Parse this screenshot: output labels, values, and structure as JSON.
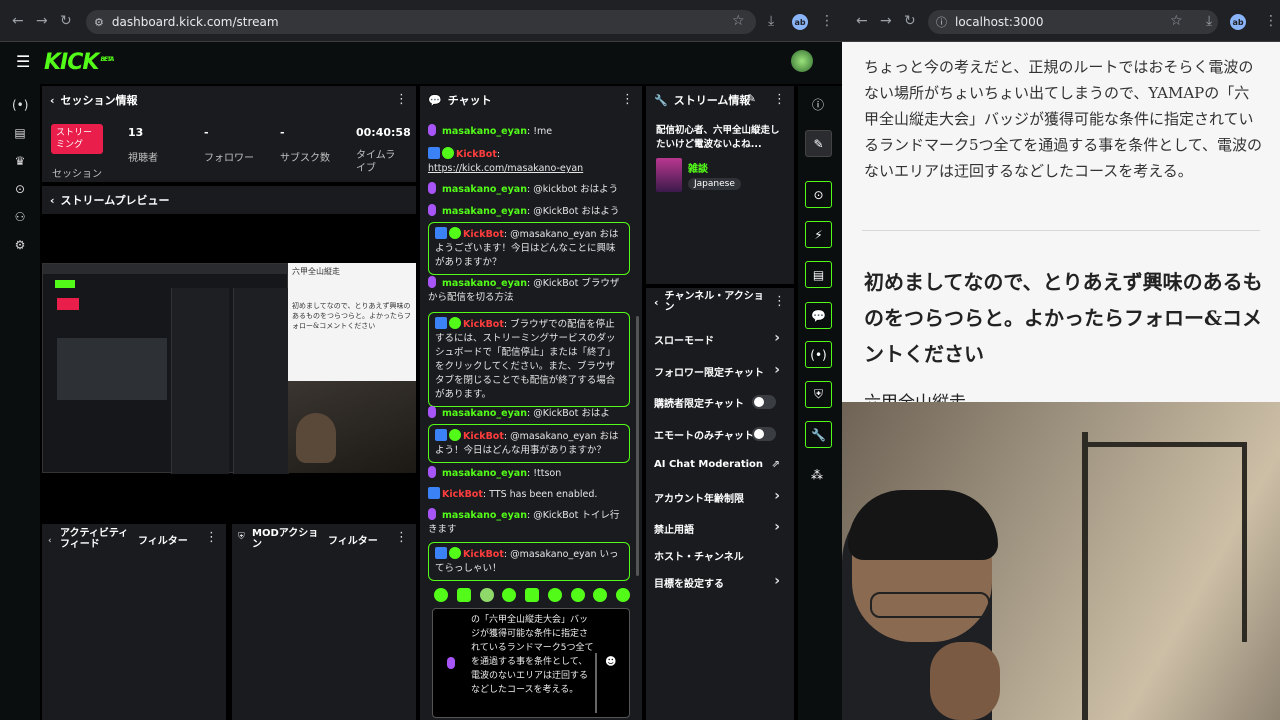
{
  "browser_left": {
    "url": "dashboard.kick.com/stream",
    "profile": "ab"
  },
  "browser_right": {
    "url": "localhost:3000",
    "profile": "ab"
  },
  "logo": {
    "text": "KICK",
    "sup": "BETA"
  },
  "session": {
    "title": "セッション情報",
    "live_button": "ストリーミング",
    "live_caption": "セッション",
    "stats": [
      {
        "value": "13",
        "label": "視聴者"
      },
      {
        "value": "-",
        "label": "フォロワー"
      },
      {
        "value": "-",
        "label": "サブスク数"
      },
      {
        "value": "00:40:58",
        "label": "タイムライブ"
      }
    ]
  },
  "preview": {
    "title": "ストリームプレビュー"
  },
  "activity": {
    "title": "アクティビティフィード",
    "filter": "フィルター"
  },
  "mod": {
    "title": "MODアクション",
    "filter": "フィルター"
  },
  "chat": {
    "title": "チャット",
    "messages": [
      {
        "user": "masakano_eyan",
        "text": "!me",
        "type": "user"
      },
      {
        "user": "KickBot",
        "text": "https://kick.com/masakano-eyan",
        "type": "bot"
      },
      {
        "user": "masakano_eyan",
        "text": "@kickbot おはよう",
        "type": "user"
      },
      {
        "user": "masakano_eyan",
        "text": "@KickBot おはよう",
        "type": "user"
      },
      {
        "user": "KickBot",
        "text": "@masakano_eyan おはようございます！今日はどんなことに興味がありますか？",
        "type": "bot-box"
      },
      {
        "user": "masakano_eyan",
        "text": "@KickBot ブラウザから配信を切る方法",
        "type": "user"
      },
      {
        "user": "KickBot",
        "text": "ブラウザでの配信を停止するには、ストリーミングサービスのダッシュボードで「配信停止」または「終了」をクリックしてください。また、ブラウザタブを閉じることでも配信が終了する場合があります。",
        "type": "bot-box"
      },
      {
        "user": "masakano_eyan",
        "text": "@KickBot おはよ",
        "type": "user"
      },
      {
        "user": "KickBot",
        "text": "@masakano_eyan おはよう！今日はどんな用事がありますか？",
        "type": "bot-box"
      },
      {
        "user": "masakano_eyan",
        "text": "!ttson",
        "type": "user"
      },
      {
        "user": "KickBot",
        "text": "TTS has been enabled.",
        "type": "bot"
      },
      {
        "user": "masakano_eyan",
        "text": "@KickBot トイレ行きます",
        "type": "user"
      },
      {
        "user": "KickBot",
        "text": "@masakano_eyan いってらっしゃい！",
        "type": "bot-box"
      }
    ],
    "input_text": "の「六甲全山縦走大会」バッジが獲得可能な条件に指定されているランドマーク5つ全てを通過する事を条件として、電波のないエリアは迂回するなどしたコースを考える。"
  },
  "stream_info": {
    "title": "ストリーム情報",
    "stream_title": "配信初心者、六甲全山縦走したいけど電波ないよね...",
    "category": "雑談",
    "language": "Japanese"
  },
  "channel_actions": {
    "title": "チャンネル・アクション",
    "items": [
      {
        "label": "スローモード",
        "control": "arrow"
      },
      {
        "label": "フォロワー限定チャット",
        "control": "arrow"
      },
      {
        "label": "購読者限定チャット",
        "control": "toggle"
      },
      {
        "label": "エモートのみチャット",
        "control": "toggle"
      },
      {
        "label": "AI Chat Moderation",
        "control": "external"
      },
      {
        "label": "アカウント年齢制限",
        "control": "arrow"
      },
      {
        "label": "禁止用語",
        "control": "arrow"
      },
      {
        "label": "ホスト・チャンネル",
        "control": "none"
      },
      {
        "label": "目標を設定する",
        "control": "arrow"
      }
    ]
  },
  "note": {
    "paragraph": "ちょっと今の考えだと、正規のルートではおそらく電波のない場所がちょいちょい出てしまうので、YAMAPの「六甲全山縦走大会」バッジが獲得可能な条件に指定されているランドマーク5つ全てを通過する事を条件として、電波のないエリアは迂回するなどしたコースを考える。",
    "heading": "初めましてなので、とりあえず興味のあるものをつらつらと。よかったらフォロー&コメントください",
    "cut_text": "六甲全山縦走"
  },
  "preview_overlay": {
    "heading": "六甲全山縦走",
    "excerpt": "初めましてなので、とりあえず興味のあるものをつらつらと。よかったらフォロー&コメントください"
  },
  "colors": {
    "accent": "#53fc18",
    "live": "#e91e4a",
    "bot": "#ff3d3d",
    "panel": "#191b1f"
  }
}
